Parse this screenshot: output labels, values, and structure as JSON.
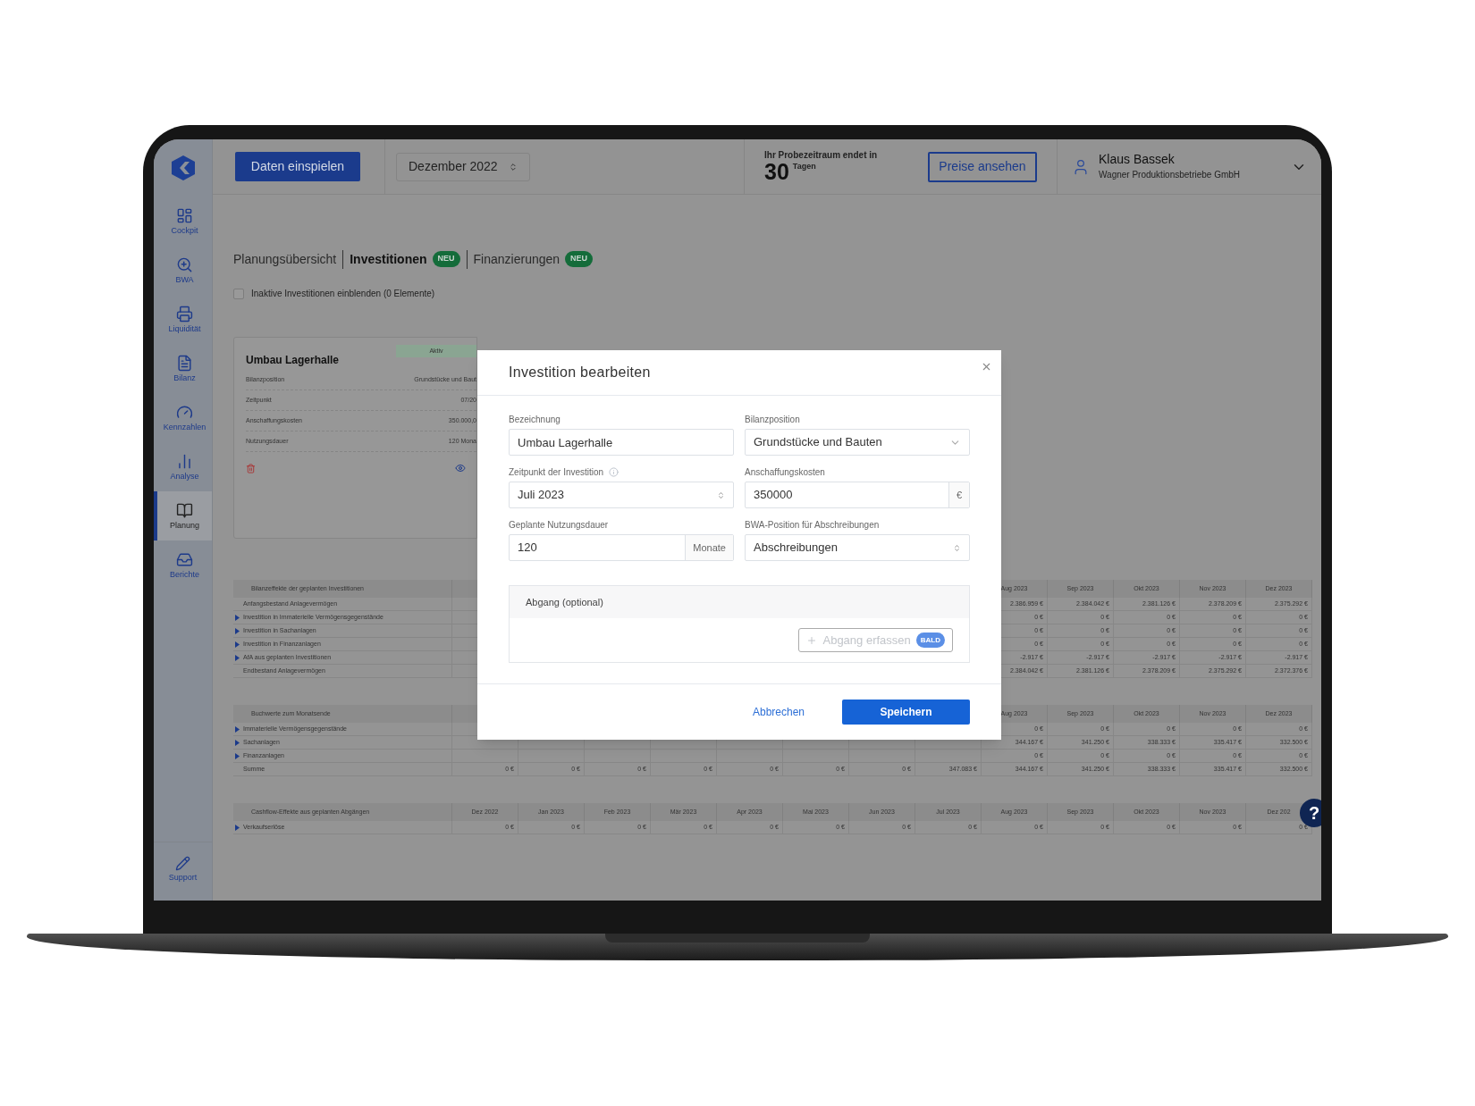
{
  "sidebar": {
    "items": [
      {
        "label": "Cockpit",
        "selected": false
      },
      {
        "label": "BWA",
        "selected": false
      },
      {
        "label": "Liquidität",
        "selected": false
      },
      {
        "label": "Bilanz",
        "selected": false
      },
      {
        "label": "Kennzahlen",
        "selected": false
      },
      {
        "label": "Analyse",
        "selected": false
      },
      {
        "label": "Planung",
        "selected": true
      },
      {
        "label": "Berichte",
        "selected": false
      }
    ],
    "support": "Support"
  },
  "topbar": {
    "import_button": "Daten einspielen",
    "period": "Dezember 2022",
    "trial": {
      "text": "Ihr Probezeitraum endet in",
      "days": "30",
      "unit": "Tagen"
    },
    "prices_button": "Preise ansehen",
    "user": {
      "name": "Klaus Bassek",
      "company": "Wagner Produktionsbetriebe GmbH"
    }
  },
  "tabs": [
    {
      "label": "Planungsübersicht",
      "selected": false
    },
    {
      "label": "Investitionen",
      "selected": true,
      "badge": "NEU"
    },
    {
      "label": "Finanzierungen",
      "selected": false,
      "badge": "NEU"
    }
  ],
  "checkbox": {
    "label": "Inaktive Investitionen einblenden (0 Elemente)",
    "checked": false
  },
  "card": {
    "title": "Umbau Lagerhalle",
    "status": "Aktiv",
    "rows": [
      {
        "label": "Bilanzposition",
        "value": "Grundstücke und Baut"
      },
      {
        "label": "Zeitpunkt",
        "value": "07/20"
      },
      {
        "label": "Anschaffungskosten",
        "value": "350.000,0"
      },
      {
        "label": "Nutzungsdauer",
        "value": "120 Mona"
      }
    ]
  },
  "tables": [
    {
      "title": "Bilanzeffekte der geplanten Investitionen",
      "columns": [
        "Aug 2023",
        "Sep 2023",
        "Okt 2023",
        "Nov 2023",
        "Dez 2023"
      ],
      "rows": [
        {
          "label": "Anfangsbestand Anlagevermögen",
          "expandable": false,
          "values": [
            "2.386.959 €",
            "2.384.042 €",
            "2.381.126 €",
            "2.378.209 €",
            "2.375.292 €"
          ]
        },
        {
          "label": "Investition in Immaterielle Vermögensgegenstände",
          "expandable": true,
          "values": [
            "0 €",
            "0 €",
            "0 €",
            "0 €",
            "0 €"
          ]
        },
        {
          "label": "Investition in Sachanlagen",
          "expandable": true,
          "values": [
            "0 €",
            "0 €",
            "0 €",
            "0 €",
            "0 €"
          ]
        },
        {
          "label": "Investition in Finanzanlagen",
          "expandable": true,
          "values": [
            "0 €",
            "0 €",
            "0 €",
            "0 €",
            "0 €"
          ]
        },
        {
          "label": "AfA aus geplanten Investitionen",
          "expandable": true,
          "values": [
            "-2.917 €",
            "-2.917 €",
            "-2.917 €",
            "-2.917 €",
            "-2.917 €"
          ]
        },
        {
          "label": "Endbestand Anlagevermögen",
          "expandable": false,
          "values": [
            "2.384.042 €",
            "2.381.126 €",
            "2.378.209 €",
            "2.375.292 €",
            "2.372.376 €"
          ]
        }
      ]
    },
    {
      "title": "Buchwerte zum Monatsende",
      "columns": [
        "Aug 2023",
        "Sep 2023",
        "Okt 2023",
        "Nov 2023",
        "Dez 2023"
      ],
      "rows": [
        {
          "label": "Immaterielle Vermögensgegenstände",
          "expandable": true,
          "values": [
            "0 €",
            "0 €",
            "0 €",
            "0 €",
            "0 €"
          ]
        },
        {
          "label": "Sachanlagen",
          "expandable": true,
          "values": [
            "344.167 €",
            "341.250 €",
            "338.333 €",
            "335.417 €",
            "332.500 €"
          ]
        },
        {
          "label": "Finanzanlagen",
          "expandable": true,
          "values": [
            "0 €",
            "0 €",
            "0 €",
            "0 €",
            "0 €"
          ]
        },
        {
          "label": "Summe",
          "expandable": false,
          "values": [
            "0 €",
            "0 €",
            "0 €",
            "0 €",
            "0 €",
            "0 €",
            "0 €",
            "347.083 €",
            "344.167 €",
            "341.250 €",
            "338.333 €",
            "335.417 €",
            "332.500 €"
          ]
        }
      ]
    },
    {
      "title": "Cashflow-Effekte aus geplanten Abgängen",
      "columns": [
        "Dez 2022",
        "Jan 2023",
        "Feb 2023",
        "Mär 2023",
        "Apr 2023",
        "Mai 2023",
        "Jun 2023",
        "Jul 2023",
        "Aug 2023",
        "Sep 2023",
        "Okt 2023",
        "Nov 2023",
        "Dez 202"
      ],
      "rows": [
        {
          "label": "Verkaufserlöse",
          "expandable": true,
          "values": [
            "0 €",
            "0 €",
            "0 €",
            "0 €",
            "0 €",
            "0 €",
            "0 €",
            "0 €",
            "0 €",
            "0 €",
            "0 €",
            "0 €",
            "0 €"
          ]
        }
      ]
    }
  ],
  "help_button": "?",
  "modal": {
    "title": "Investition bearbeiten",
    "fields": [
      {
        "label": "Bezeichnung",
        "value": "Umbau Lagerhalle",
        "kind": "text",
        "info": false
      },
      {
        "label": "Bilanzposition",
        "value": "Grundstücke und Bauten",
        "kind": "select",
        "info": false
      },
      {
        "label": "Zeitpunkt der Investition",
        "value": "Juli 2023",
        "kind": "spinner",
        "info": true
      },
      {
        "label": "Anschaffungskosten",
        "value": "350000",
        "kind": "addon",
        "addon": "€",
        "info": false
      },
      {
        "label": "Geplante Nutzungsdauer",
        "value": "120",
        "kind": "addon",
        "addon": "Monate",
        "info": false
      },
      {
        "label": "BWA-Position für Abschreibungen",
        "value": "Abschreibungen",
        "kind": "spinner",
        "info": false
      }
    ],
    "section": {
      "title": "Abgang (optional)",
      "button": "Abgang erfassen",
      "disabled": true,
      "badge": "BALD"
    },
    "cancel": "Abbrechen",
    "save": "Speichern"
  }
}
